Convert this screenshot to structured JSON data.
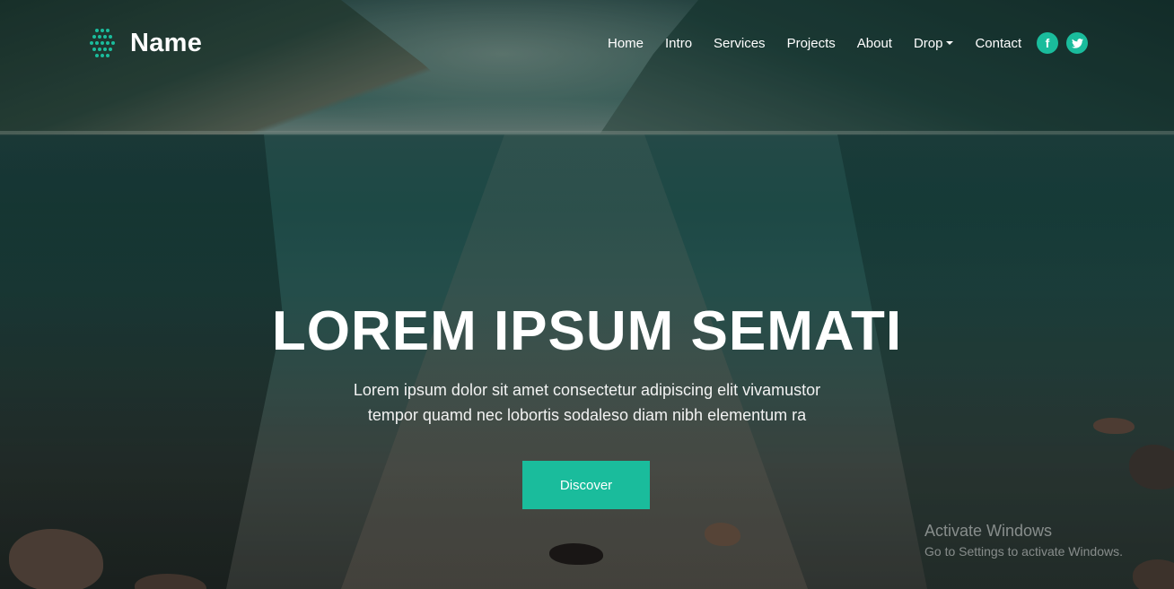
{
  "brand": {
    "name": "Name",
    "logo_icon": "dotted-hexagon-logo-icon"
  },
  "nav": {
    "items": [
      {
        "label": "Home"
      },
      {
        "label": "Intro"
      },
      {
        "label": "Services"
      },
      {
        "label": "Projects"
      },
      {
        "label": "About"
      },
      {
        "label": "Drop",
        "has_dropdown": true
      },
      {
        "label": "Contact"
      }
    ]
  },
  "social": [
    {
      "icon": "facebook-icon",
      "glyph": "f"
    },
    {
      "icon": "twitter-icon",
      "glyph": "t"
    }
  ],
  "hero": {
    "headline": "LOREM IPSUM SEMATI",
    "subtitle_line1": "Lorem ipsum dolor sit amet consectetur adipiscing elit vivamustor",
    "subtitle_line2": "tempor quamd nec lobortis sodaleso diam nibh elementum ra",
    "cta_label": "Discover"
  },
  "watermark": {
    "title": "Activate Windows",
    "subtitle": "Go to Settings to activate Windows."
  },
  "colors": {
    "accent": "#1abc9c",
    "text": "#ffffff"
  }
}
